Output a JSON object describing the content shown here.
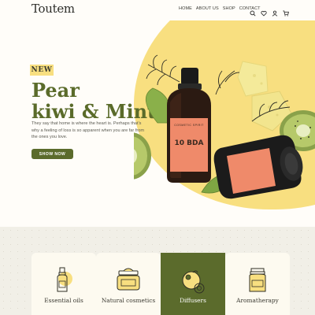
{
  "brand": {
    "logo": "Toutem"
  },
  "nav": {
    "items": [
      "HOME",
      "ABOUT US",
      "SHOP",
      "CONTACT"
    ],
    "icons": [
      "search-icon",
      "heart-icon",
      "user-icon",
      "cart-icon"
    ]
  },
  "hero": {
    "badge": "NEW",
    "title_line1": "Pear",
    "title_line2": "kiwi & Mint",
    "text": "They say that home is where the heart is. Perhaps that's why a feeling of loss is so apparent when you are far from the ones you love.",
    "cta": "SHOW NOW",
    "bottle_label_small": "COSMETIC SPIRIT",
    "bottle_label_brand": "10 BDA",
    "accent_color": "#f8df80",
    "primary_color": "#5b6b2c"
  },
  "categories": [
    {
      "label": "Essential oils",
      "icon": "essential-oil-bottle-icon",
      "active": false
    },
    {
      "label": "Natural cosmetics",
      "icon": "cream-jar-icon",
      "active": false
    },
    {
      "label": "Diffusers",
      "icon": "diffuser-icon",
      "active": true
    },
    {
      "label": "Aromatherapy",
      "icon": "aroma-candle-icon",
      "active": false
    }
  ]
}
